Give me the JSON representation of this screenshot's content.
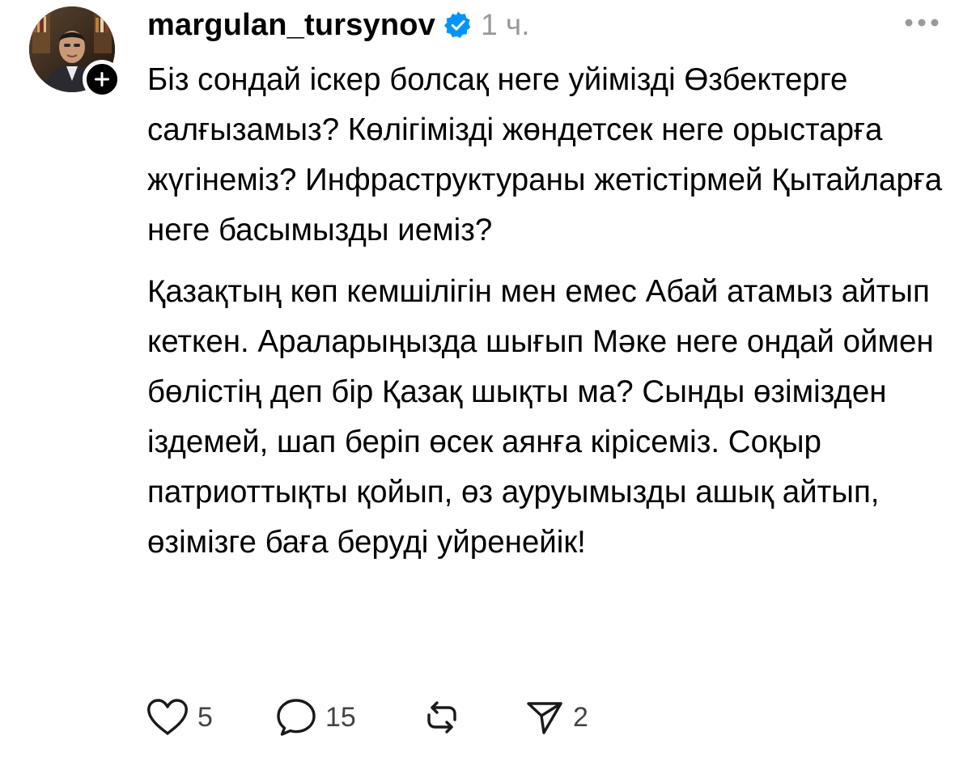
{
  "post": {
    "username": "margulan_tursynov",
    "verified": true,
    "timestamp": "1 ч.",
    "paragraphs": [
      "Біз сондай іскер болсақ неге уйімізді Өзбектерге салғызамыз? Көлігімізді жөндетсек неге орыстарға жүгінеміз? Инфраструктураны жетістірмей Қытайларға неге басымызды иеміз?",
      "Қазақтың көп кемшілігін мен емес Абай атамыз айтып кеткен. Араларыңызда шығып Мәке неге ондай оймен бөлістің деп бір Қазақ шықты ма? Сынды өзімізден іздемей, шап беріп өсек аянға кірісеміз. Соқыр патриоттықты қойып, өз ауруымызды ашық айтып, өзімізге баға беруді уйренейік!"
    ]
  },
  "actions": {
    "likes": "5",
    "comments": "15",
    "shares": "2"
  },
  "icons": {
    "verified": "verified-badge-icon",
    "follow": "plus-icon",
    "more": "more-horizontal-icon",
    "like": "heart-icon",
    "comment": "comment-bubble-icon",
    "repost": "repost-icon",
    "share": "send-icon"
  },
  "colors": {
    "verified_blue": "#0095F6",
    "text": "#000000",
    "muted": "#999999"
  }
}
